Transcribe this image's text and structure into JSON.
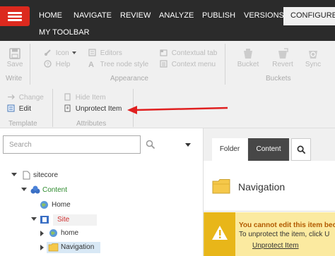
{
  "nav": {
    "tabs": [
      "HOME",
      "NAVIGATE",
      "REVIEW",
      "ANALYZE",
      "PUBLISH",
      "VERSIONS",
      "CONFIGURE"
    ],
    "active_tab": "CONFIGURE",
    "toolbar_label": "MY TOOLBAR"
  },
  "ribbon": {
    "write": {
      "save": "Save",
      "label": "Write"
    },
    "appearance": {
      "icon": "Icon",
      "help": "Help",
      "editors": "Editors",
      "tree_node_style": "Tree node style",
      "contextual_tab": "Contextual tab",
      "context_menu": "Context menu",
      "label": "Appearance"
    },
    "buckets": {
      "bucket": "Bucket",
      "revert": "Revert",
      "sync": "Sync",
      "label": "Buckets"
    },
    "template": {
      "change": "Change",
      "edit": "Edit",
      "label": "Template"
    },
    "attributes": {
      "hide_item": "Hide Item",
      "unprotect_item": "Unprotect Item",
      "label": "Attributes"
    }
  },
  "search": {
    "placeholder": "Search"
  },
  "tree": {
    "sitecore": "sitecore",
    "content": "Content",
    "home": "Home",
    "site": "Site",
    "home_child": "home",
    "navigation": "Navigation"
  },
  "editor": {
    "tabs": {
      "folder": "Folder",
      "content": "Content"
    },
    "item_title": "Navigation",
    "warning": {
      "line1": "You cannot edit this item beca",
      "line2": "To unprotect the item, click U",
      "link": "Unprotect Item"
    }
  },
  "colors": {
    "brand_red": "#dc291e",
    "arrow_red": "#e02020",
    "content_green": "#2e8b2e",
    "site_red": "#d03030",
    "warning_bg": "#fbeaa0",
    "warning_badge": "#e8b619"
  },
  "icons": {
    "menu": "hamburger-icon",
    "save": "floppy-icon",
    "search": "magnifier-icon",
    "folder": "folder-icon",
    "warning": "warning-triangle-icon"
  }
}
